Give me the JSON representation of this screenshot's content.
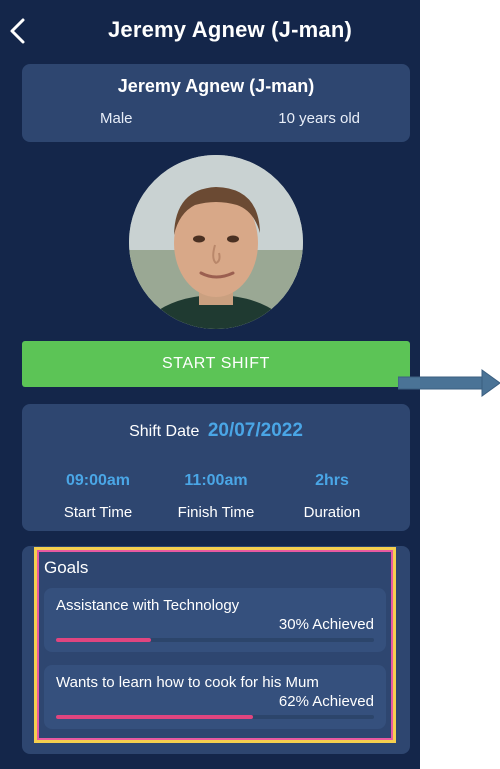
{
  "header": {
    "title": "Jeremy Agnew (J-man)",
    "back_icon": "chevron-left-icon"
  },
  "profile": {
    "name": "Jeremy Agnew (J-man)",
    "gender": "Male",
    "age": "10 years old"
  },
  "start_button": {
    "label": "START SHIFT"
  },
  "shift": {
    "date_label": "Shift Date",
    "date": "20/07/2022",
    "start_time": "09:00am",
    "start_label": "Start Time",
    "finish_time": "11:00am",
    "finish_label": "Finish Time",
    "duration": "2hrs",
    "duration_label": "Duration"
  },
  "goals": {
    "title": "Goals",
    "items": [
      {
        "name": "Assistance with Technology",
        "achieved": "30% Achieved",
        "progress": 0.3
      },
      {
        "name": "Wants to learn how to cook for his Mum",
        "achieved": "62% Achieved",
        "progress": 0.62
      }
    ]
  },
  "colors": {
    "background": "#14264a",
    "card": "#2e4670",
    "accent_blue": "#4aa6e6",
    "button_green": "#5cc456",
    "progress_pink": "#e0457f",
    "highlight_yellow": "#f5cf4e",
    "arrow": "#4a7396"
  }
}
